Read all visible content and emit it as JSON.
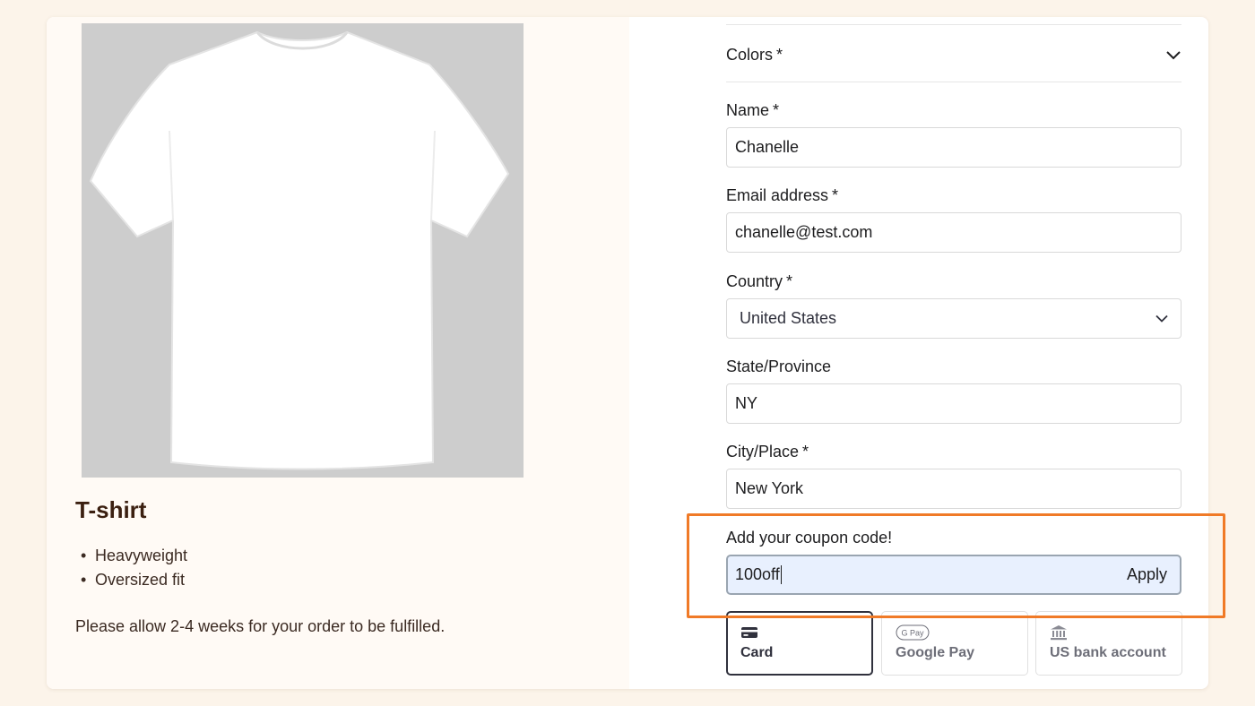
{
  "product": {
    "image_alt": "White t-shirt",
    "title": "T-shirt",
    "features": [
      "Heavyweight",
      "Oversized fit"
    ],
    "fulfillment_note": "Please allow 2-4 weeks for your order to be fulfilled."
  },
  "form": {
    "colors": {
      "label": "Colors",
      "required": "*",
      "icon": "chevron-down-icon"
    },
    "name": {
      "label": "Name",
      "required": "*",
      "value": "Chanelle"
    },
    "email": {
      "label": "Email address",
      "required": "*",
      "value": "chanelle@test.com"
    },
    "country": {
      "label": "Country",
      "required": "*",
      "value": "United States",
      "icon": "chevron-down-icon"
    },
    "state": {
      "label": "State/Province",
      "value": "NY"
    },
    "city": {
      "label": "City/Place",
      "required": "*",
      "value": "New York"
    },
    "coupon": {
      "label": "Add your coupon code!",
      "value": "100off",
      "apply_label": "Apply"
    }
  },
  "payment_tabs": [
    {
      "label": "Card",
      "icon": "credit-card-icon",
      "selected": true
    },
    {
      "label": "Google Pay",
      "icon": "google-pay-icon",
      "selected": false
    },
    {
      "label": "US bank account",
      "icon": "bank-icon",
      "selected": false
    }
  ],
  "colors": {
    "highlight": "#f07a27",
    "coupon_background": "#e8f0fe",
    "page_background": "#fcf4ea",
    "title": "#3b1f10"
  }
}
